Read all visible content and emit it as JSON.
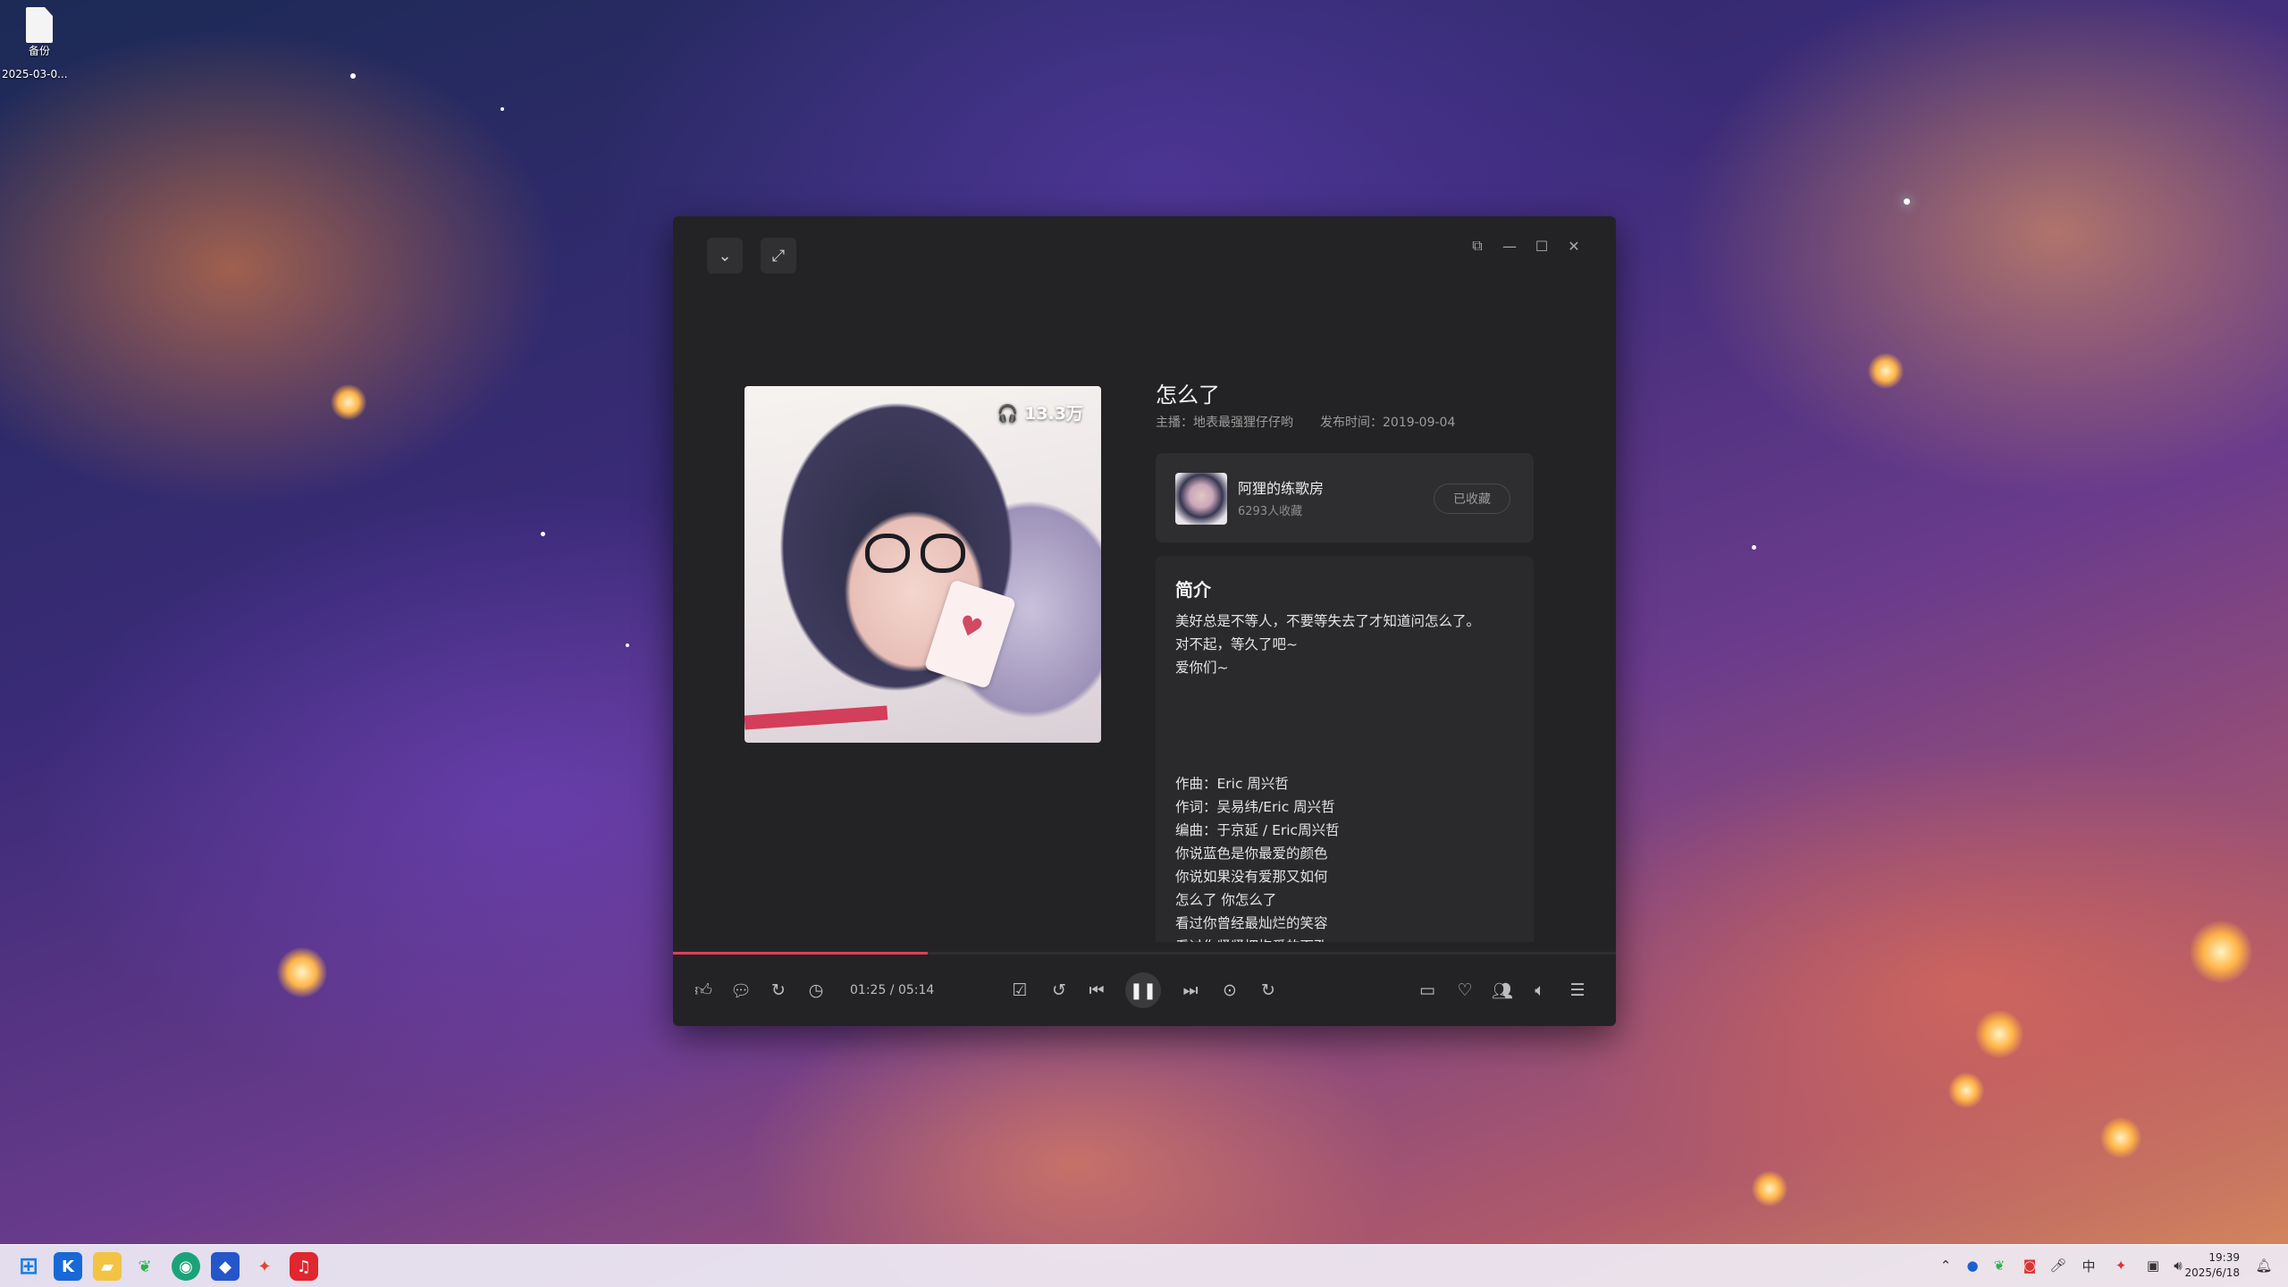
{
  "desktop": {
    "icon_label": "备份",
    "icon_date": "2025-03-0..."
  },
  "player": {
    "song_title": "怎么了",
    "host_label": "主播：地表最强狸仔仔哟",
    "release_label": "发布时间：2019-09-04",
    "cover_play_count": "13.3万",
    "album": {
      "name": "阿狸的练歌房",
      "subscribers": "6293人收藏",
      "collect_button": "已收藏"
    },
    "intro": {
      "title": "简介",
      "lines_top": [
        "美好总是不等人，不要等失去了才知道问怎么了。",
        "对不起，等久了吧~",
        "爱你们~"
      ],
      "lines_bottom": [
        "作曲：Eric 周兴哲",
        "作词：吴易纬/Eric 周兴哲",
        "编曲：于京延 / Eric周兴哲",
        "你说蓝色是你最爱的颜色",
        "你说如果没有爱那又如何",
        "怎么了 你怎么了",
        "看过你曾经最灿烂的笑容",
        "看过你紧紧拥抱爱的面孔"
      ]
    },
    "time_display": "01:25 / 05:14",
    "progress_fraction": 0.27,
    "accent_color": "#e0405a"
  },
  "taskbar": {
    "clock_time": "19:39",
    "clock_date": "2025/6/18"
  }
}
